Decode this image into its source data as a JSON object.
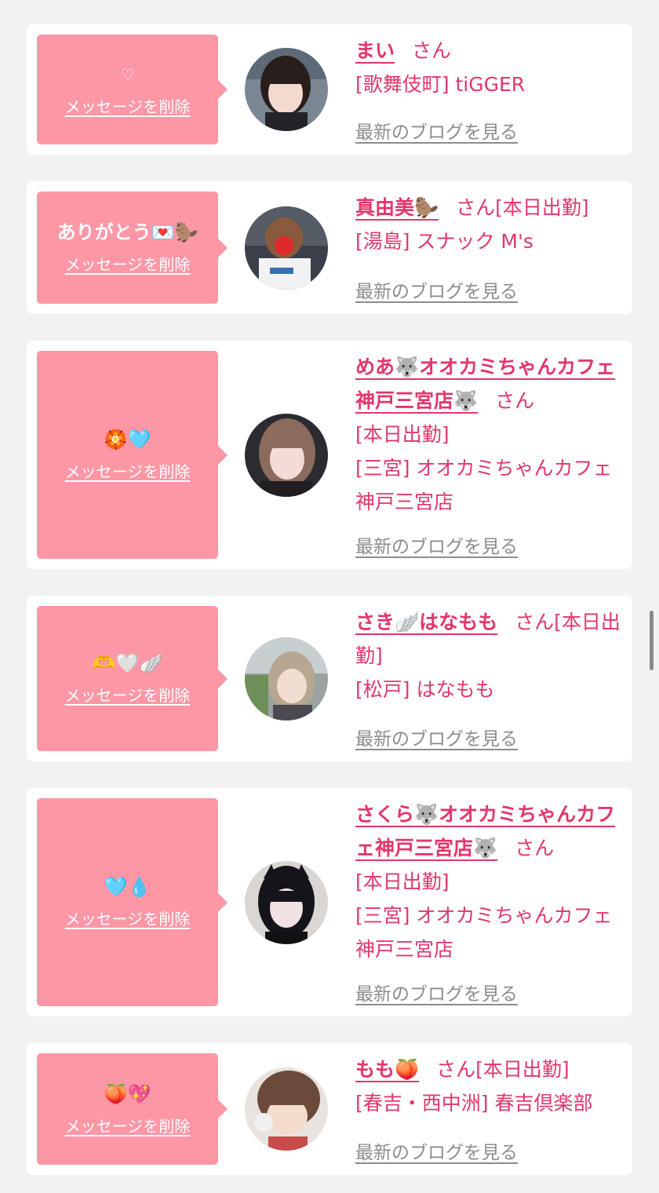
{
  "colors": {
    "background": "#f2f2f2",
    "card": "#ffffff",
    "message_box": "#fd97a6",
    "accent_pink": "#e2376a",
    "link_gray": "#8c8c8c"
  },
  "delete_label": "メッセージを削除",
  "blog_label": "最新のブログを見る",
  "cards": [
    {
      "message": "♡",
      "name": "まい",
      "suffix": "さん",
      "status": "",
      "shop": "[歌舞伎町] tiGGER"
    },
    {
      "message": "ありがとう💌🦫",
      "name": "真由美🦫",
      "suffix": "さん",
      "status": "[本日出勤]",
      "shop": "[湯島] スナック M's"
    },
    {
      "message": "🏵️🩵",
      "name": "めあ🐺オオカミちゃんカフェ神戸三宮店🐺",
      "suffix": "さん",
      "status": "[本日出勤]",
      "shop": "[三宮] オオカミちゃんカフェ神戸三宮店"
    },
    {
      "message": "🫶🤍🪽",
      "name": "さき🪽はなもも",
      "suffix": "さん",
      "status": "[本日出勤]",
      "shop": "[松戸] はなもも"
    },
    {
      "message": "🩵💧",
      "name": "さくら🐺オオカミちゃんカフェ神戸三宮店🐺",
      "suffix": "さん",
      "status": "[本日出勤]",
      "shop": "[三宮] オオカミちゃんカフェ神戸三宮店"
    },
    {
      "message": "🍑💖",
      "name": "もも🍑",
      "suffix": "さん",
      "status": "[本日出勤]",
      "shop": "[春吉・西中洲] 春吉倶楽部"
    }
  ]
}
